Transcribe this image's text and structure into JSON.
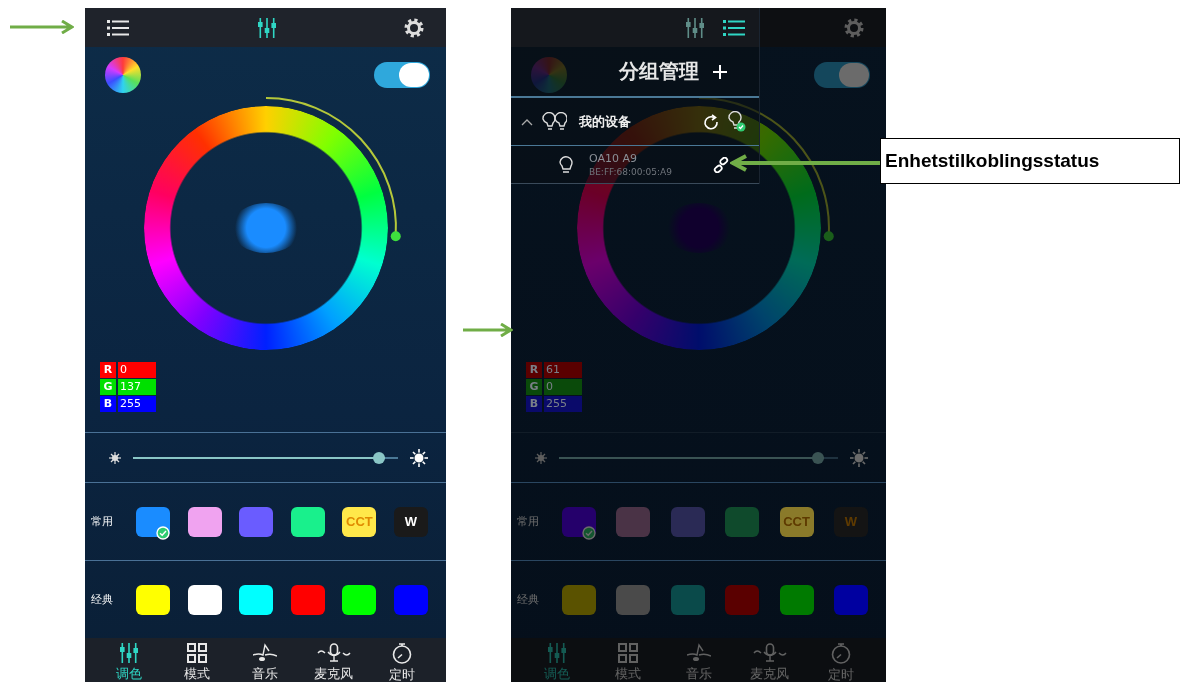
{
  "phones": [
    {
      "dimmed": false,
      "top_bar": [
        {
          "kind": "list",
          "selected": false
        },
        {
          "kind": "sliders",
          "selected": true
        },
        {
          "kind": "settings"
        }
      ],
      "power_on": true,
      "rgb": [
        {
          "channel": "R",
          "value": "0",
          "color": "#ff0000"
        },
        {
          "channel": "G",
          "value": "137",
          "color": "#00e000"
        },
        {
          "channel": "B",
          "value": "255",
          "color": "#0000ff"
        }
      ],
      "brightness": {
        "level": 0.95
      },
      "preset_rows": [
        {
          "label": "常用",
          "swatches": [
            {
              "color": "#1a8cff",
              "selected": true
            },
            {
              "color": "#f0a3f0",
              "selected": false
            },
            {
              "color": "#6a5cff",
              "selected": false
            },
            {
              "color": "#19f08c",
              "selected": false
            },
            {
              "color": "#ffe84a",
              "text": "CCT",
              "selected": false
            },
            {
              "color": "#1a1a1a",
              "text": "W",
              "selected": false
            }
          ]
        },
        {
          "label": "经典",
          "swatches": [
            {
              "color": "#ffff00"
            },
            {
              "color": "#ffffff"
            },
            {
              "color": "#00ffff"
            },
            {
              "color": "#ff0000"
            },
            {
              "color": "#00ff00"
            },
            {
              "color": "#0000ff"
            }
          ]
        }
      ],
      "nav": [
        {
          "kind": "sliders",
          "label": "调色",
          "selected": true
        },
        {
          "kind": "grid",
          "label": "模式",
          "selected": false
        },
        {
          "kind": "music",
          "label": "音乐",
          "selected": false
        },
        {
          "kind": "mic",
          "label": "麦克风",
          "selected": false
        },
        {
          "kind": "timer",
          "label": "定时",
          "selected": false
        }
      ]
    },
    {
      "dimmed": true,
      "top_bar": [
        {
          "kind": "settings"
        }
      ],
      "power_on": true,
      "rgb": [
        {
          "channel": "R",
          "value": "61",
          "color": "#5a0000"
        },
        {
          "channel": "G",
          "value": "0",
          "color": "#0a4a0a"
        },
        {
          "channel": "B",
          "value": "255",
          "color": "#0a0a6a"
        }
      ],
      "brightness": {
        "level": 0.95
      },
      "preset_rows": [
        {
          "label": "常用",
          "swatches": [
            {
              "color": "#25006b",
              "selected": true
            },
            {
              "color": "#4a3346",
              "selected": false
            },
            {
              "color": "#2a2a55",
              "selected": false
            },
            {
              "color": "#0f4a2c",
              "selected": false
            },
            {
              "color": "#8a7a2a",
              "text": "CCT",
              "selected": false
            },
            {
              "color": "#141414",
              "text": "W",
              "selected": false
            }
          ]
        },
        {
          "label": "经典",
          "swatches": [
            {
              "color": "#5a5200"
            },
            {
              "color": "#4a4a4a"
            },
            {
              "color": "#0a4a4a"
            },
            {
              "color": "#5a0000"
            },
            {
              "color": "#007a00"
            },
            {
              "color": "#0000a0"
            }
          ]
        }
      ],
      "nav": [
        {
          "kind": "sliders",
          "label": "调色",
          "selected": true
        },
        {
          "kind": "grid",
          "label": "模式",
          "selected": false
        },
        {
          "kind": "music",
          "label": "音乐",
          "selected": false
        },
        {
          "kind": "mic",
          "label": "麦克风",
          "selected": false
        },
        {
          "kind": "timer",
          "label": "定时",
          "selected": false
        }
      ],
      "drawer": {
        "top_bar": [
          {
            "kind": "sliders",
            "selected": false
          },
          {
            "kind": "list",
            "selected": true
          }
        ],
        "title": "分组管理",
        "group": {
          "name": "我的设备",
          "expanded": true
        },
        "devices": [
          {
            "name": "OA10 A9",
            "address": "BE:FF:68:00:05:A9",
            "connected": true
          }
        ]
      }
    }
  ],
  "callout": {
    "label": "Enhetstilkoblingsstatus"
  }
}
